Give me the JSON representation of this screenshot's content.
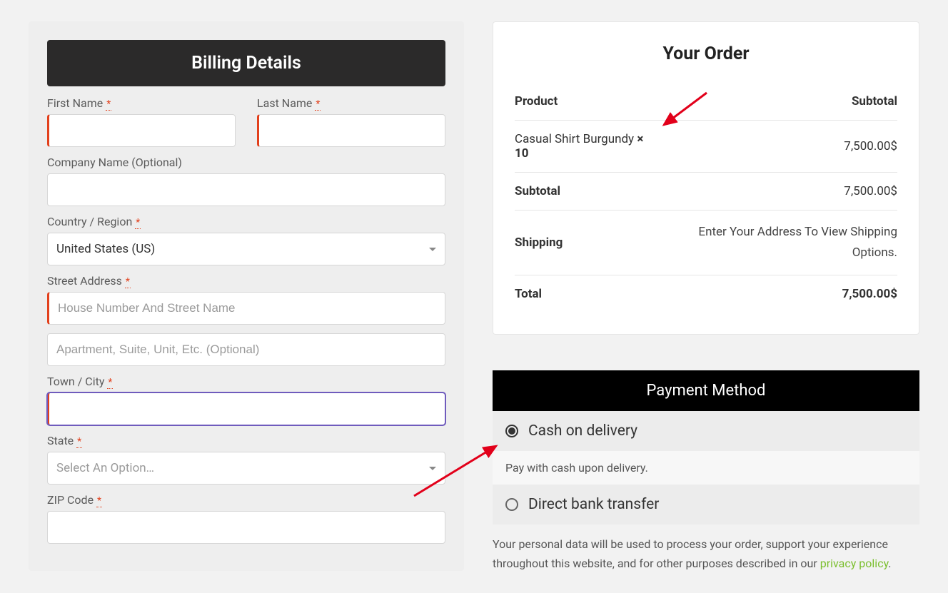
{
  "billing": {
    "title": "Billing Details",
    "first_name_label": "First Name",
    "last_name_label": "Last Name",
    "company_label": "Company Name (Optional)",
    "country_label": "Country / Region",
    "country_value": "United States (US)",
    "street_label": "Street Address",
    "street_placeholder": "House Number And Street Name",
    "street2_placeholder": "Apartment, Suite, Unit, Etc. (Optional)",
    "city_label": "Town / City",
    "state_label": "State",
    "state_placeholder": "Select An Option…",
    "zip_label": "ZIP Code"
  },
  "order": {
    "title": "Your Order",
    "product_header": "Product",
    "subtotal_header": "Subtotal",
    "item_name": "Casual Shirt Burgundy ",
    "item_qty": "× 10",
    "item_subtotal": "7,500.00$",
    "subtotal_label": "Subtotal",
    "subtotal_value": "7,500.00$",
    "shipping_label": "Shipping",
    "shipping_msg": "Enter Your Address To View Shipping Options.",
    "total_label": "Total",
    "total_value": "7,500.00$"
  },
  "payment": {
    "header": "Payment Method",
    "option_cod": "Cash on delivery",
    "cod_desc": "Pay with cash upon delivery.",
    "option_bank": "Direct bank transfer",
    "privacy_text": "Your personal data will be used to process your order, support your experience throughout this website, and for other purposes described in our ",
    "privacy_link": "privacy policy",
    "privacy_after": "."
  }
}
